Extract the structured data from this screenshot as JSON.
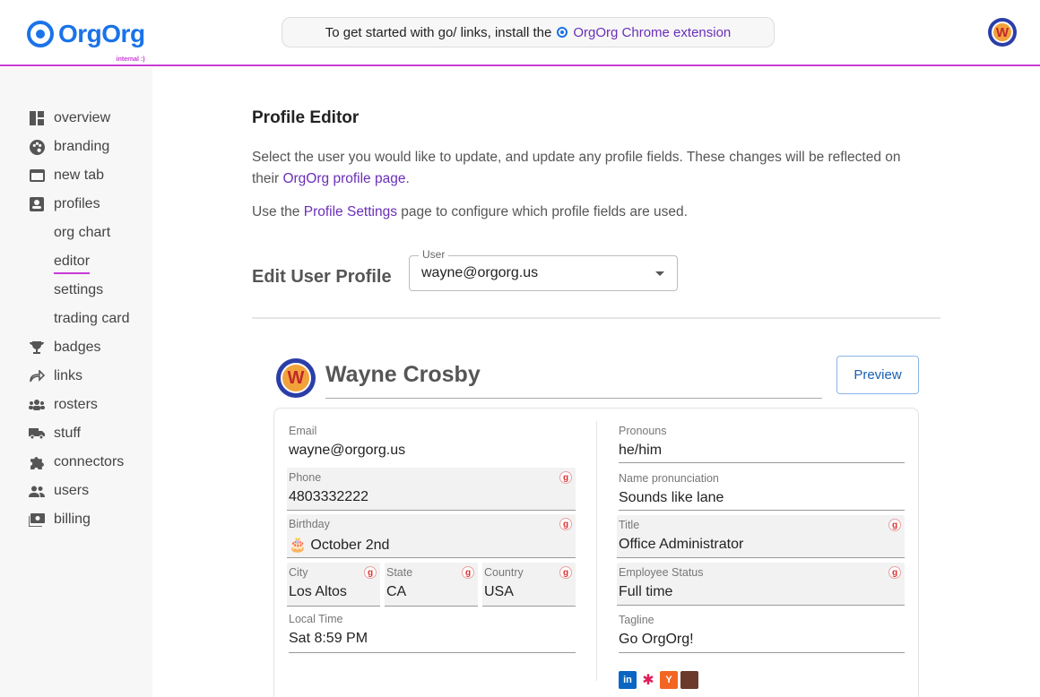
{
  "brand": {
    "name": "OrgOrg",
    "sub": "internal :)"
  },
  "banner": {
    "prefix": "To get started with go/ links, install the",
    "link": "OrgOrg Chrome extension"
  },
  "user_avatar_initial": "W",
  "sidebar": {
    "items": [
      {
        "label": "overview",
        "icon": "dashboard-icon"
      },
      {
        "label": "branding",
        "icon": "palette-icon"
      },
      {
        "label": "new tab",
        "icon": "tab-icon"
      },
      {
        "label": "profiles",
        "icon": "profile-icon"
      },
      {
        "label": "badges",
        "icon": "trophy-icon"
      },
      {
        "label": "links",
        "icon": "share-arrow-icon"
      },
      {
        "label": "rosters",
        "icon": "group-icon"
      },
      {
        "label": "stuff",
        "icon": "truck-icon"
      },
      {
        "label": "connectors",
        "icon": "puzzle-icon"
      },
      {
        "label": "users",
        "icon": "users-icon"
      },
      {
        "label": "billing",
        "icon": "billing-icon"
      }
    ],
    "sub": [
      "org chart",
      "editor",
      "settings",
      "trading card"
    ]
  },
  "main": {
    "title": "Profile Editor",
    "p1_a": "Select the user you would like to update, and update any profile fields. These changes will be reflected on",
    "p1_b": "their",
    "p1_link": "OrgOrg profile page",
    "p1_end": ".",
    "p2_a": "Use the",
    "p2_link": "Profile Settings",
    "p2_b": "page to configure which profile fields are used.",
    "edit_label": "Edit User Profile",
    "user_select": {
      "legend": "User",
      "value": "wayne@orgorg.us"
    }
  },
  "profile": {
    "avatar_initial": "W",
    "name": "Wayne Crosby",
    "preview": "Preview",
    "g_badge": "g",
    "left": {
      "email": {
        "label": "Email",
        "value": "wayne@orgorg.us"
      },
      "phone": {
        "label": "Phone",
        "value": "4803332222"
      },
      "birthday": {
        "label": "Birthday",
        "value": "🎂 October 2nd"
      },
      "city": {
        "label": "City",
        "value": "Los Altos"
      },
      "state": {
        "label": "State",
        "value": "CA"
      },
      "country": {
        "label": "Country",
        "value": "USA"
      },
      "local_time": {
        "label": "Local Time",
        "value": "Sat 8:59 PM"
      }
    },
    "right": {
      "pronouns": {
        "label": "Pronouns",
        "value": "he/him"
      },
      "pronunciation": {
        "label": "Name pronunciation",
        "value": "Sounds like lane"
      },
      "title": {
        "label": "Title",
        "value": "Office Administrator"
      },
      "status": {
        "label": "Employee Status",
        "value": "Full time"
      },
      "tagline": {
        "label": "Tagline",
        "value": "Go OrgOrg!"
      }
    },
    "socials": [
      {
        "name": "linkedin-icon",
        "text": "in",
        "color": "#0a66c2"
      },
      {
        "name": "slack-icon",
        "text": "✱",
        "color": "#e01e5a"
      },
      {
        "name": "ycombinator-icon",
        "text": "Y",
        "color": "#f26522"
      },
      {
        "name": "photo-icon",
        "text": "",
        "color": "#6b3a2a"
      }
    ]
  }
}
